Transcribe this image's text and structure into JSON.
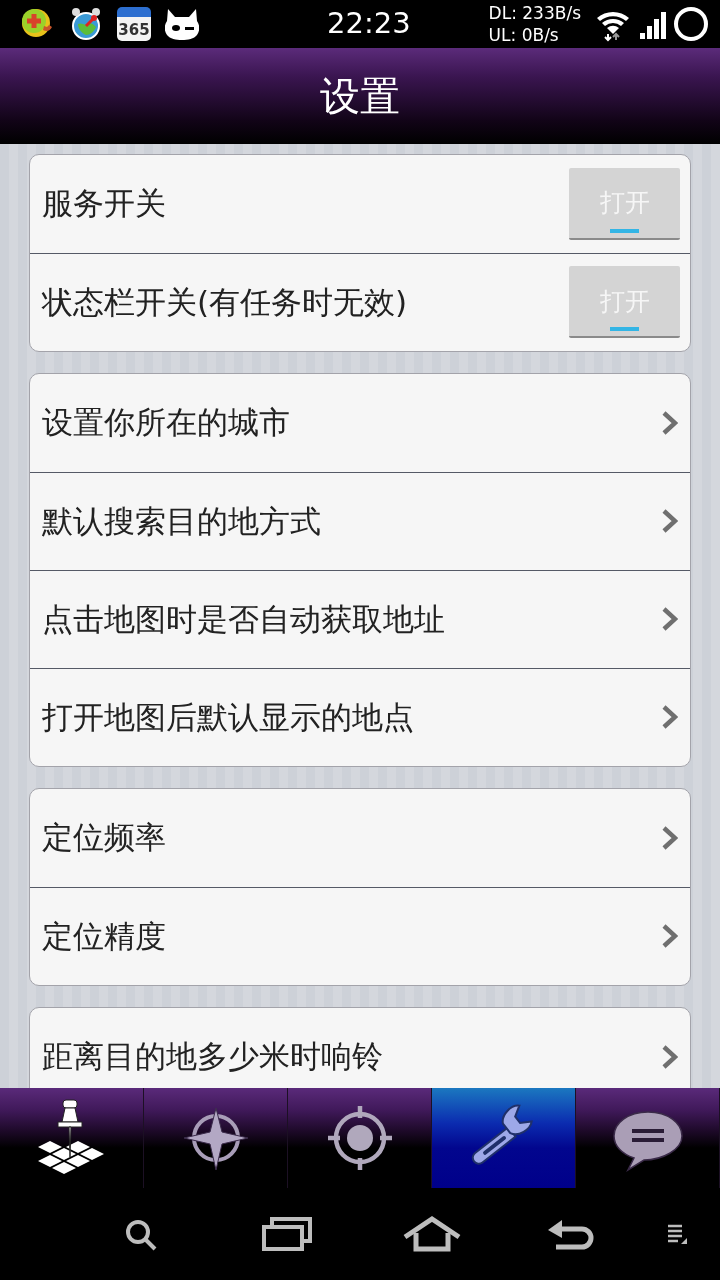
{
  "status_bar": {
    "calendar_icon_text": "365",
    "time": "22:23",
    "download_speed": "DL: 233B/s",
    "upload_speed": "UL: 0B/s"
  },
  "title": "设置",
  "groups": [
    {
      "items": [
        {
          "kind": "toggle",
          "label": "服务开关",
          "toggle": {
            "text": "打开",
            "on": true
          }
        },
        {
          "kind": "toggle",
          "label": "状态栏开关(有任务时无效)",
          "toggle": {
            "text": "打开",
            "on": true
          }
        }
      ]
    },
    {
      "items": [
        {
          "kind": "link",
          "label": "设置你所在的城市"
        },
        {
          "kind": "link",
          "label": "默认搜索目的地方式"
        },
        {
          "kind": "link",
          "label": "点击地图时是否自动获取地址"
        },
        {
          "kind": "link",
          "label": "打开地图后默认显示的地点"
        }
      ]
    },
    {
      "items": [
        {
          "kind": "link",
          "label": "定位频率"
        },
        {
          "kind": "link",
          "label": "定位精度"
        }
      ]
    },
    {
      "items": [
        {
          "kind": "link",
          "label": "距离目的地多少米时响铃"
        }
      ]
    }
  ],
  "tab_bar": {
    "tabs": [
      {
        "selected": false
      },
      {
        "selected": false
      },
      {
        "selected": false
      },
      {
        "selected": true
      },
      {
        "selected": false
      }
    ]
  }
}
